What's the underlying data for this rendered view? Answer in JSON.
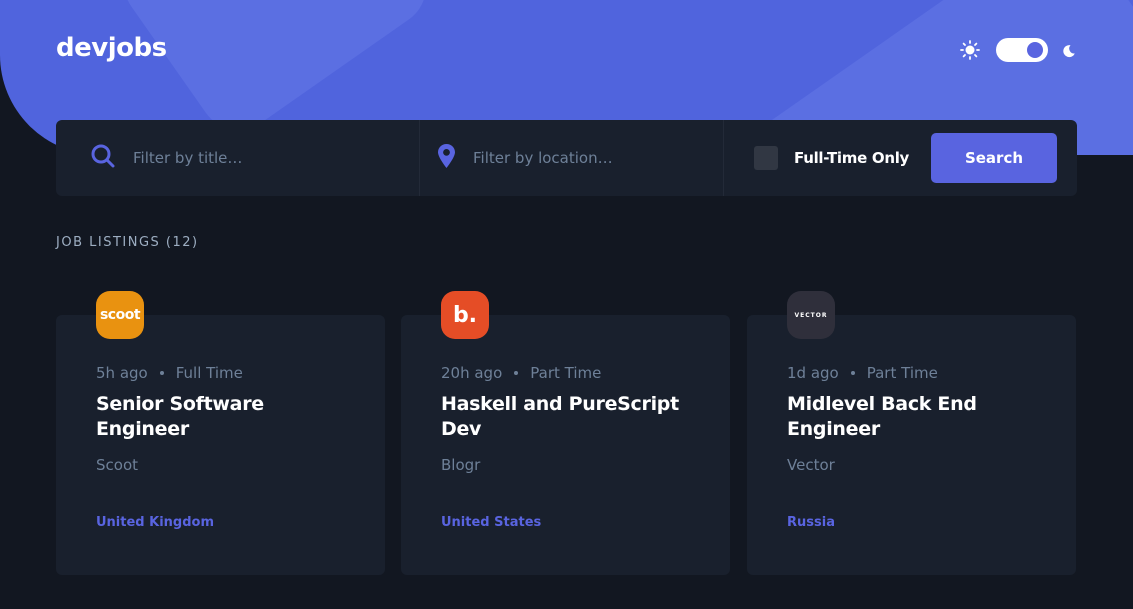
{
  "brand": {
    "logo_text": "devjobs",
    "accent": "#5964e0"
  },
  "theme_toggle": {
    "sun_icon": "sun-icon",
    "moon_icon": "moon-icon",
    "state": "dark"
  },
  "search": {
    "title_placeholder": "Filter by title…",
    "location_placeholder": "Filter by location…",
    "fulltime_label": "Full-Time Only",
    "button_label": "Search"
  },
  "listings": {
    "heading": "JOB LISTINGS (12)",
    "jobs": [
      {
        "logo_text": "scoot",
        "logo_color": "#e99210",
        "posted": "5h ago",
        "contract": "Full Time",
        "title": "Senior Software Engineer",
        "company": "Scoot",
        "location": "United Kingdom"
      },
      {
        "logo_text": "b.",
        "logo_color": "#e54d26",
        "posted": "20h ago",
        "contract": "Part Time",
        "title": "Haskell and PureScript Dev",
        "company": "Blogr",
        "location": "United States"
      },
      {
        "logo_text": "VECTOR",
        "logo_color": "#2f2f3b",
        "posted": "1d ago",
        "contract": "Part Time",
        "title": "Midlevel Back End Engineer",
        "company": "Vector",
        "location": "Russia"
      }
    ]
  }
}
